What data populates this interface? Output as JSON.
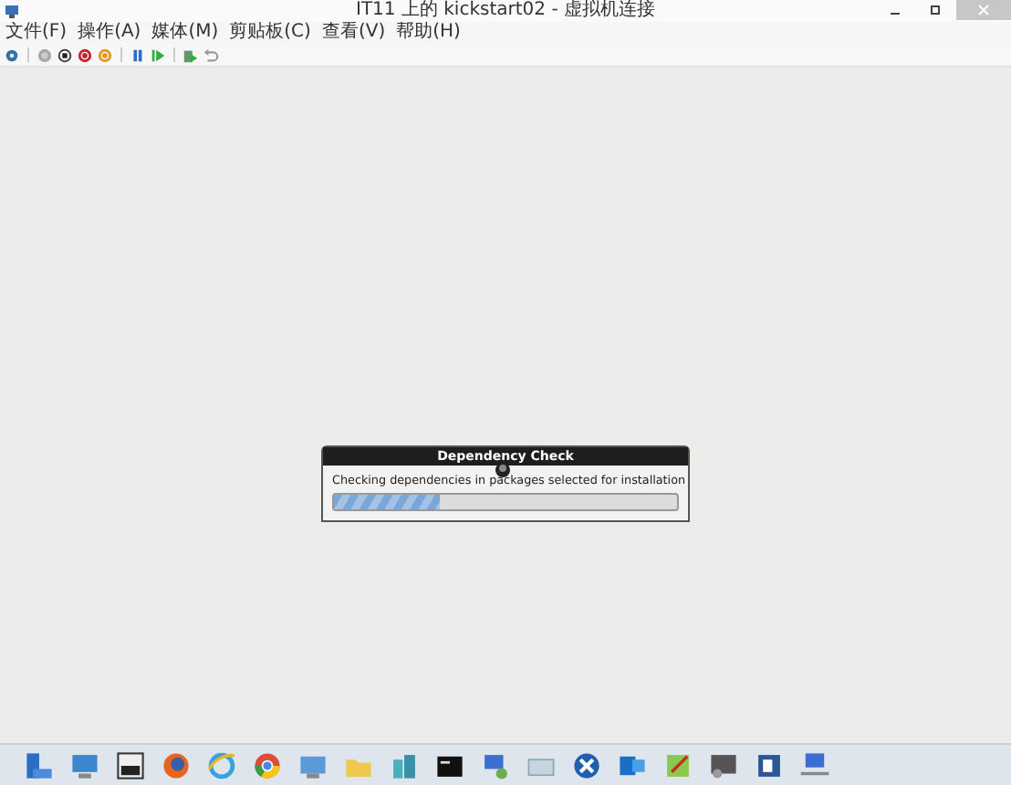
{
  "window": {
    "title": "IT11 上的 kickstart02 - 虚拟机连接"
  },
  "menu": [
    "文件(F)",
    "操作(A)",
    "媒体(M)",
    "剪贴板(C)",
    "查看(V)",
    "帮助(H)"
  ],
  "dialog": {
    "title": "Dependency Check",
    "message": "Checking dependencies in packages selected for installation",
    "progress": {
      "level": 0.31
    }
  }
}
